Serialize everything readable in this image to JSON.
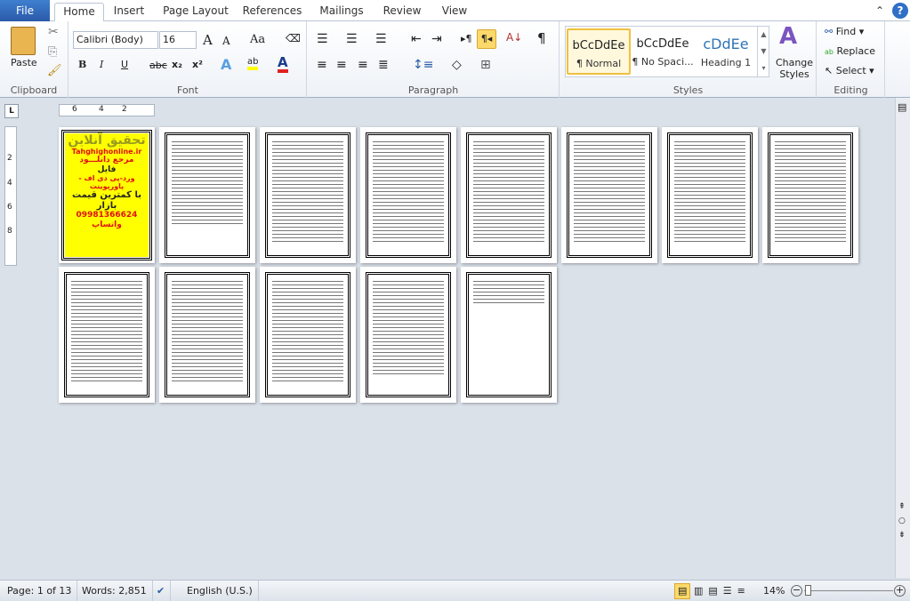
{
  "tabs": [
    "File",
    "Home",
    "Insert",
    "Page Layout",
    "References",
    "Mailings",
    "Review",
    "View"
  ],
  "clipboard": {
    "paste": "Paste",
    "label": "Clipboard"
  },
  "font": {
    "name": "Calibri (Body)",
    "size": "16",
    "label": "Font",
    "case": "Aa",
    "bold": "B",
    "italic": "I",
    "underline": "U",
    "strike": "abc",
    "sub": "x₂",
    "sup": "x²",
    "grow": "A",
    "shrink": "A"
  },
  "paragraph": {
    "label": "Paragraph",
    "pilcrow": "¶"
  },
  "styles": {
    "label": "Styles",
    "items": [
      {
        "preview": "bCcDdEe",
        "name": "¶ Normal"
      },
      {
        "preview": "bCcDdEe",
        "name": "¶ No Spaci..."
      },
      {
        "preview": "cDdEe",
        "name": "Heading 1"
      }
    ],
    "change": "Change Styles"
  },
  "editing": {
    "label": "Editing",
    "find": "Find",
    "replace": "Replace",
    "select": "Select"
  },
  "ruler": {
    "h": [
      "6",
      "4",
      "2"
    ],
    "v": [
      "2",
      "4",
      "6",
      "8"
    ]
  },
  "cover": {
    "title": "تحقیق آنلاین",
    "site": "Tahghighonline.ir",
    "line1": "مرجع دانلـــود",
    "line2": "فایل",
    "line3": "ورد-پی دی اف - پاورپوینت",
    "line4": "با کمترین قیمت بازار",
    "phone": "09981366624",
    "whatsapp": "واتساپ"
  },
  "pages": [
    {
      "fill": 0.9
    },
    {
      "fill": 0.75
    },
    {
      "fill": 0.92
    },
    {
      "fill": 0.92
    },
    {
      "fill": 0.92
    },
    {
      "fill": 0.92
    },
    {
      "fill": 0.92
    },
    {
      "fill": 0.92
    },
    {
      "fill": 0.92
    },
    {
      "fill": 0.92
    },
    {
      "fill": 0.92
    },
    {
      "fill": 0.85
    },
    {
      "fill": 0.22
    }
  ],
  "status": {
    "page": "Page: 1 of 13",
    "words": "Words: 2,851",
    "language": "English (U.S.)",
    "zoom": "14%"
  },
  "colors": {
    "accent": "#2b5ca8",
    "highlight": "#ffff00",
    "font_color": "#e02020"
  }
}
